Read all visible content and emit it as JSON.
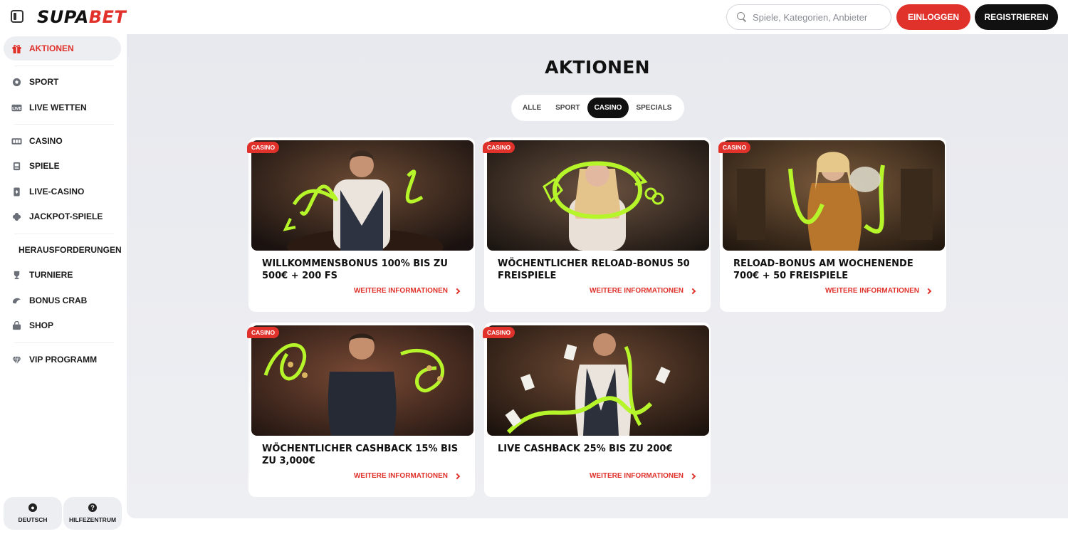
{
  "header": {
    "logo_part1": "SUPA",
    "logo_part2": "BET",
    "search_placeholder": "Spiele, Kategorien, Anbieter",
    "login_label": "EINLOGGEN",
    "register_label": "REGISTRIEREN"
  },
  "sidebar": {
    "items": [
      {
        "label": "AKTIONEN",
        "icon": "gift-icon",
        "active": true
      },
      {
        "label": "SPORT",
        "icon": "soccer-ball-icon"
      },
      {
        "label": "LIVE WETTEN",
        "icon": "live-icon"
      },
      {
        "label": "CASINO",
        "icon": "slot-machine-icon"
      },
      {
        "label": "SPIELE",
        "icon": "game-machine-icon"
      },
      {
        "label": "LIVE-CASINO",
        "icon": "card-icon"
      },
      {
        "label": "JACKPOT-SPIELE",
        "icon": "clover-icon"
      },
      {
        "label": "HERAUSFORDERUNGEN",
        "icon": "badge-icon"
      },
      {
        "label": "TURNIERE",
        "icon": "trophy-icon"
      },
      {
        "label": "BONUS CRAB",
        "icon": "crab-icon"
      },
      {
        "label": "SHOP",
        "icon": "shop-icon"
      },
      {
        "label": "VIP PROGRAMM",
        "icon": "diamond-icon"
      }
    ],
    "language_label": "DEUTSCH",
    "help_label": "HILFEZENTRUM"
  },
  "main": {
    "title": "AKTIONEN",
    "tabs": [
      {
        "label": "ALLE"
      },
      {
        "label": "SPORT"
      },
      {
        "label": "CASINO",
        "active": true
      },
      {
        "label": "SPECIALS"
      }
    ],
    "cards": [
      {
        "badge": "CASINO",
        "title": "WILLKOMMENSBONUS 100% BIS ZU 500€ + 200 FS",
        "link": "WEITERE INFORMATIONEN"
      },
      {
        "badge": "CASINO",
        "title": "WÖCHENTLICHER RELOAD-BONUS 50 FREISPIELE",
        "link": "WEITERE INFORMATIONEN"
      },
      {
        "badge": "CASINO",
        "title": "RELOAD-BONUS AM WOCHENENDE 700€ + 50 FREISPIELE",
        "link": "WEITERE INFORMATIONEN"
      },
      {
        "badge": "CASINO",
        "title": "WÖCHENTLICHER CASHBACK 15% BIS ZU 3,000€",
        "link": "WEITERE INFORMATIONEN"
      },
      {
        "badge": "CASINO",
        "title": "LIVE CASHBACK 25% BIS ZU 200€",
        "link": "WEITERE INFORMATIONEN"
      }
    ]
  },
  "colors": {
    "accent_red": "#e0312b",
    "dark": "#111111",
    "neon_green": "#b6f52a"
  }
}
